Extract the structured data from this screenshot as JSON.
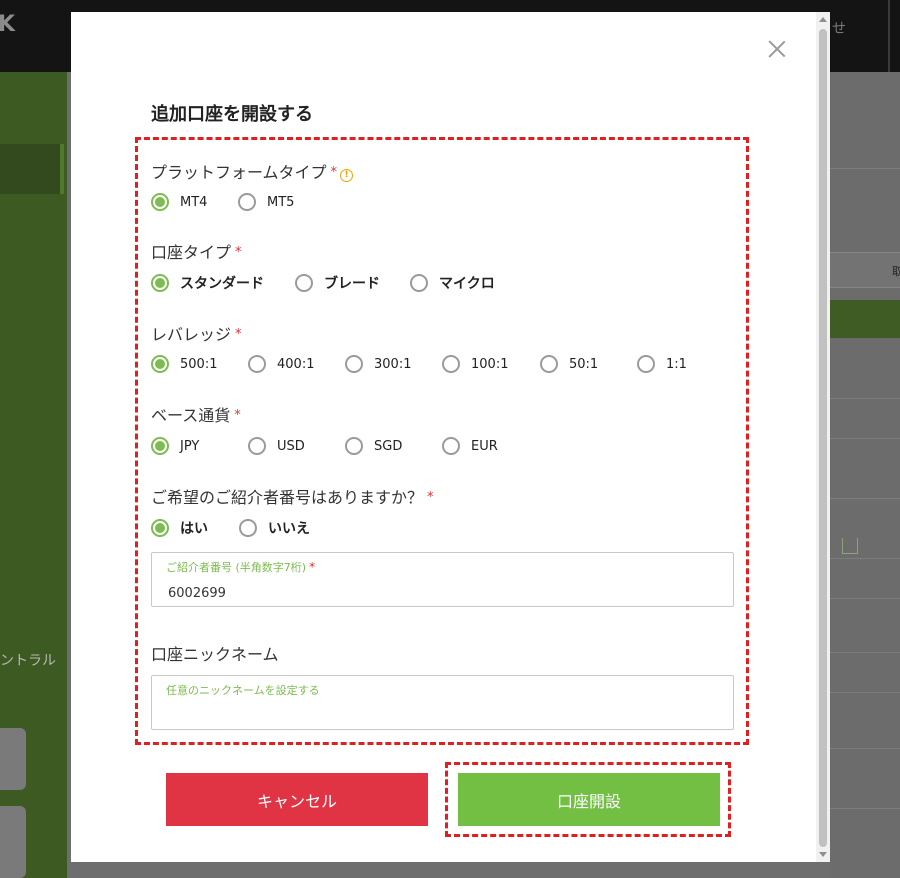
{
  "background": {
    "top_right_text": "せ",
    "sidebar_label": "ントラル",
    "right_tab_text": "取"
  },
  "modal": {
    "title": "追加口座を開設する",
    "platform": {
      "label": "プラットフォームタイプ",
      "required": "*",
      "info_icon": "!",
      "options": [
        "MT4",
        "MT5"
      ],
      "selected": "MT4"
    },
    "account_type": {
      "label": "口座タイプ",
      "required": "*",
      "options": [
        "スタンダード",
        "ブレード",
        "マイクロ"
      ],
      "selected": "スタンダード"
    },
    "leverage": {
      "label": "レバレッジ",
      "required": "*",
      "options": [
        "500:1",
        "400:1",
        "300:1",
        "100:1",
        "50:1",
        "1:1"
      ],
      "selected": "500:1"
    },
    "base_currency": {
      "label": "ベース通貨",
      "required": "*",
      "options": [
        "JPY",
        "USD",
        "SGD",
        "EUR"
      ],
      "selected": "JPY"
    },
    "referral": {
      "label": "ご希望のご紹介者番号はありますか？",
      "required": "*",
      "options": [
        "はい",
        "いいえ"
      ],
      "selected": "はい"
    },
    "referral_number": {
      "label": "ご紹介者番号 (半角数字7桁)",
      "required": "*",
      "value": "6002699"
    },
    "nickname": {
      "label": "口座ニックネーム",
      "placeholder": "任意のニックネームを設定する"
    },
    "buttons": {
      "cancel": "キャンセル",
      "open": "口座開設"
    },
    "colors": {
      "accent_green": "#72bf44",
      "cancel_red": "#e03444",
      "highlight_dash": "#e02020",
      "info_orange": "#f2a100"
    }
  }
}
